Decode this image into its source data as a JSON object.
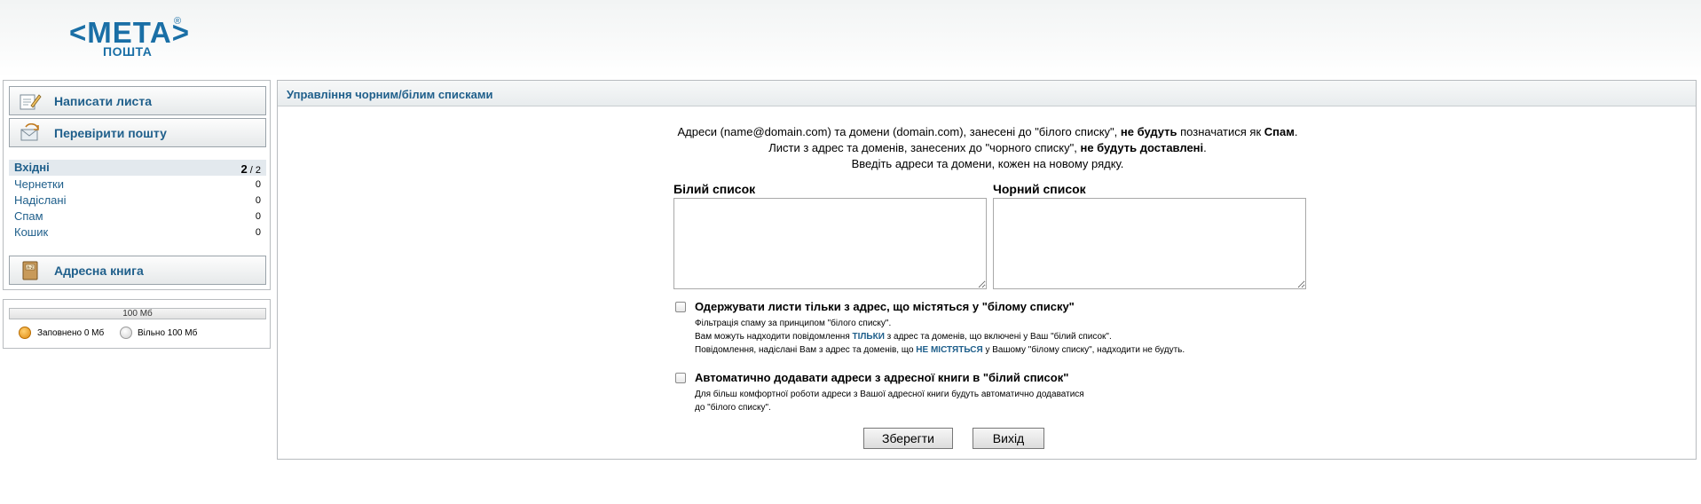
{
  "logo": {
    "brand": "<МЕТА",
    "brand_tail": ">",
    "registered": "®",
    "sub": "ПОШТА"
  },
  "sidebar": {
    "compose_label": "Написати листа",
    "check_label": "Перевірити пошту",
    "folders": [
      {
        "name": "Вхідні",
        "unread": "2",
        "total": "/ 2"
      },
      {
        "name": "Чернетки",
        "count": "0"
      },
      {
        "name": "Надіслані",
        "count": "0"
      },
      {
        "name": "Спам",
        "count": "0"
      },
      {
        "name": "Кошик",
        "count": "0"
      }
    ],
    "addressbook_label": "Адресна книга"
  },
  "quota": {
    "total": "100 Мб",
    "used_label": "Заповнено 0 Мб",
    "free_label": "Вільно 100 Мб",
    "used_fraction": 0
  },
  "main": {
    "title": "Управління чорним/білим списками",
    "intro": {
      "line1_a": "Адреси (name@domain.com) та домени (domain.com), занесені до \"білого списку\", ",
      "line1_b": "не будуть",
      "line1_c": " позначатися як ",
      "line1_d": "Спам",
      "line1_e": ".",
      "line2_a": "Листи з адрес та доменів, занесених до \"чорного списку\", ",
      "line2_b": "не будуть доставлені",
      "line2_c": ".",
      "line3": "Введіть адреси та домени, кожен на новому рядку."
    },
    "whitelist_label": "Білий список",
    "blacklist_label": "Чорний список",
    "whitelist_value": "",
    "blacklist_value": "",
    "option1": {
      "title": "Одержувати листи тільки з адрес, що містяться у \"білому списку\"",
      "d1": "Фільтрація спаму за принципом \"білого списку\".",
      "d2_a": "Вам можуть надходити повідомлення ",
      "d2_b": "ТІЛЬКИ",
      "d2_c": " з адрес та доменів, що включені у Ваш \"білий список\".",
      "d3_a": "Повідомлення, надіслані Вам з адрес та доменів, що ",
      "d3_b": "НЕ МІСТЯТЬСЯ",
      "d3_c": " у Вашому \"білому списку\", надходити не будуть.",
      "checked": false
    },
    "option2": {
      "title": "Автоматично додавати адреси з адресної книги в \"білий список\"",
      "d1": "Для більш комфортної роботи адреси з Вашої адресної книги будуть автоматично додаватися",
      "d2": "до \"білого списку\".",
      "checked": false
    },
    "save_label": "Зберегти",
    "exit_label": "Вихід"
  },
  "colors": {
    "accent": "#1f5f8b",
    "logo": "#1a6fa6",
    "border": "#b8bcbf",
    "used": "#f0a020"
  }
}
